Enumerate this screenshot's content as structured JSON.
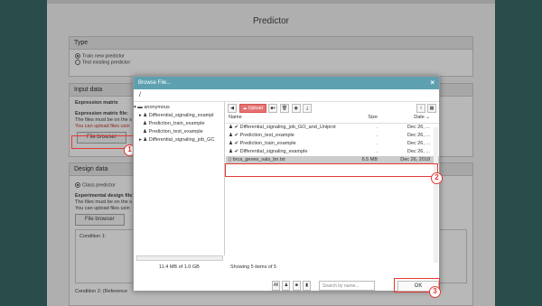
{
  "page": {
    "title": "Predictor",
    "type_panel": {
      "header": "Type",
      "options": [
        "Train new predictor",
        "Test existing predictor"
      ]
    },
    "input_panel": {
      "header": "Input data",
      "sub_header": "Expression matrix",
      "field_label": "Expression matrix file:",
      "help1": "The files must be on the s",
      "help2": "You can upload files usin",
      "button": "File browser"
    },
    "design_panel": {
      "header": "Design data",
      "option1": "Class predictor",
      "field_label": "Experimental design file:",
      "help1": "The files must be on the s",
      "help2": "You can upload files usin",
      "button": "File browser",
      "cond1": "Condition 1:",
      "cond2": "Condition 2: (Reference"
    }
  },
  "dialog": {
    "title": "Browse File...",
    "path": "/",
    "tree": {
      "root": "anonymous",
      "items": [
        "Differential_signaling_exampl",
        "Prediction_train_example",
        "Prediction_test_example",
        "Differential_signaling_job_GC"
      ]
    },
    "toolbar": {
      "upload": "Upload",
      "folder_plus": "+"
    },
    "columns": {
      "name": "Name",
      "size": "Size",
      "date": "Date"
    },
    "files": [
      {
        "name": "Differential_signaling_job_GO_and_Uniprot",
        "size": ".",
        "date": "Dec 26, ..."
      },
      {
        "name": "Prediction_test_example",
        "size": ".",
        "date": "Dec 26, ..."
      },
      {
        "name": "Prediction_train_example",
        "size": ".",
        "date": "Dec 26, ..."
      },
      {
        "name": "Differential_signaling_example",
        "size": ".",
        "date": "Dec 26, ..."
      },
      {
        "name": "brca_genes_vals_bn.txt",
        "size": "6.5 MB",
        "date": "Dec 26, 2018"
      }
    ],
    "quota": "11.4 MB of 1.0 GB",
    "showing": "Showing 5 items of 5",
    "filter_all": "All",
    "search_placeholder": "Search by name...",
    "ok": "OK"
  },
  "badges": [
    "1",
    "2",
    "3"
  ],
  "colors": {
    "dialog_header": "#5da1b0",
    "annotation": "#e53935",
    "upload": "#e57373",
    "backdrop": "#3a6b68"
  }
}
